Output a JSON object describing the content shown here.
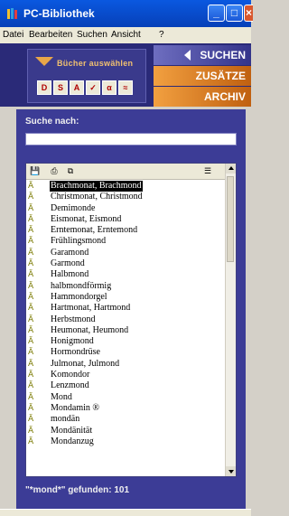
{
  "window": {
    "title": "PC-Bibliothek"
  },
  "menu": [
    "Datei",
    "Bearbeiten",
    "Suchen",
    "Ansicht",
    "?"
  ],
  "books": {
    "label": "Bücher auswählen"
  },
  "nav": {
    "suchen": "SUCHEN",
    "zusaetze": "ZUSÄTZE",
    "archiv": "ARCHIV"
  },
  "search": {
    "label": "Suche nach:",
    "value": ""
  },
  "results": {
    "items": [
      "Brachmonat, Brachmond",
      "Christmonat, Christmond",
      "Demimonde",
      "Eismonat, Eismond",
      "Erntemonat, Erntemond",
      "Frühlingsmond",
      "Garamond",
      "Garmond",
      "Halbmond",
      "halbmondförmig",
      "Hammondorgel",
      "Hartmonat, Hartmond",
      "Herbstmond",
      "Heumonat, Heumond",
      "Honigmond",
      "Hormondrüse",
      "Julmonat, Julmond",
      "Komondor",
      "Lenzmond",
      "Mond",
      "Mondamin ®",
      "mondän",
      "Mondänität",
      "Mondanzug"
    ],
    "selected_index": 0,
    "status": "\"*mond*\" gefunden: 101"
  },
  "colors": {
    "panel": "#3c3c96",
    "accent": "#e8902a"
  }
}
